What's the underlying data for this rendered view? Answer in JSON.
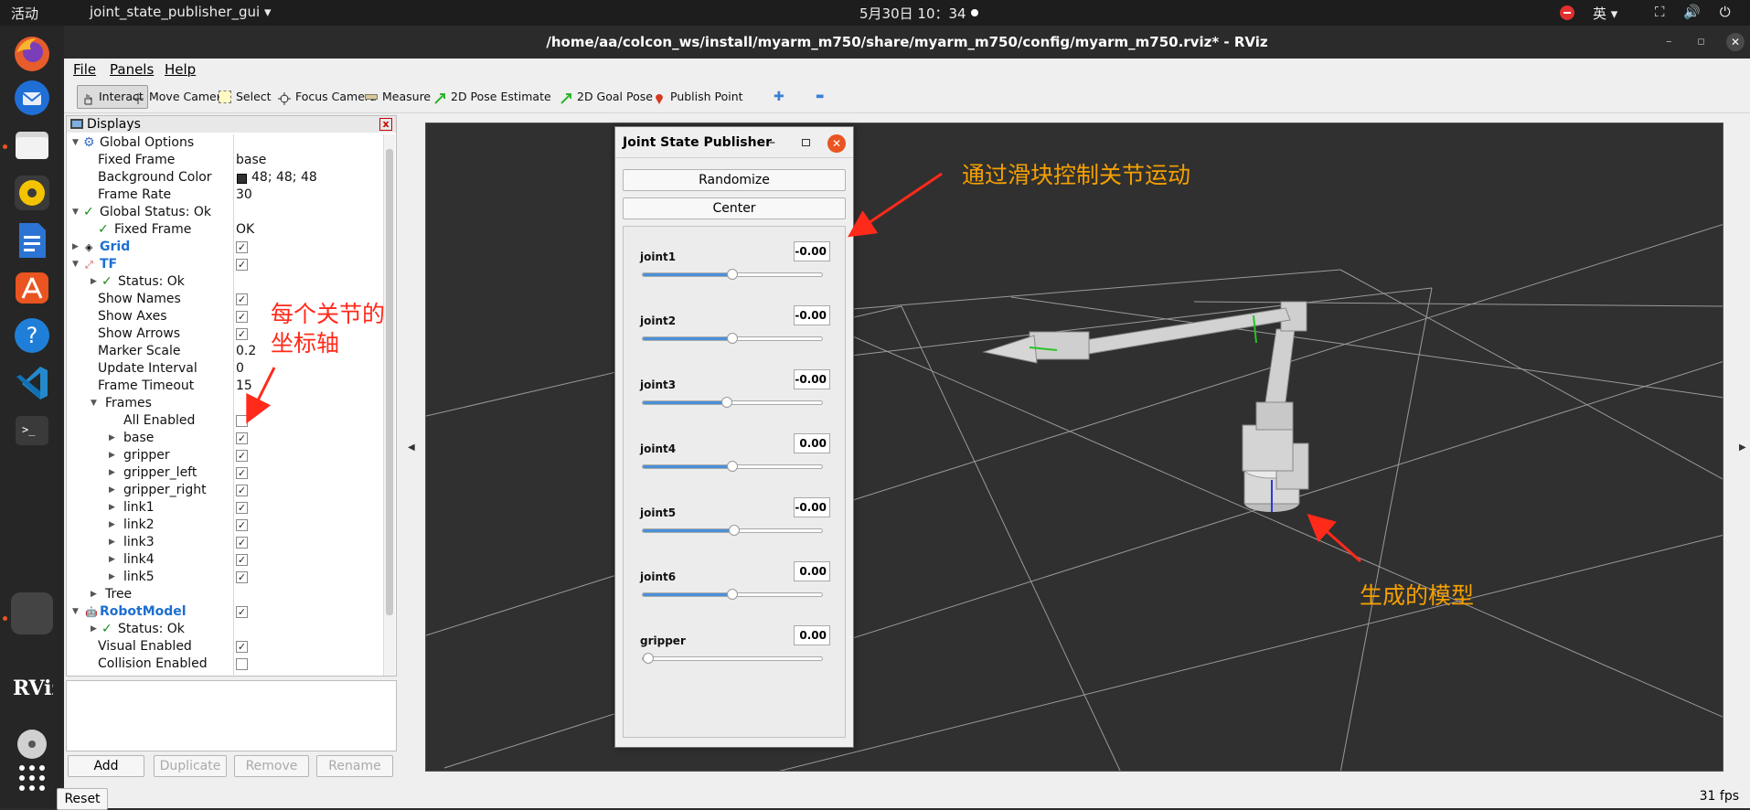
{
  "topbar": {
    "activities": "活动",
    "app_menu": "joint_state_publisher_gui ▾",
    "clock": "5月30日  10：34",
    "input_method": "英 ▾",
    "tray": "⛶ 🔊 ⏻ ▾"
  },
  "window": {
    "title": "/home/aa/colcon_ws/install/myarm_m750/share/myarm_m750/config/myarm_m750.rviz* - RViz",
    "min": "–",
    "max": "▫",
    "close": "✕"
  },
  "menu": {
    "file": "File",
    "panels": "Panels",
    "help": "Help"
  },
  "toolbar": {
    "interact": "Interact",
    "move_camera": "Move Camera",
    "select": "Select",
    "focus_camera": "Focus Camera",
    "measure": "Measure",
    "pose_estimate": "2D Pose Estimate",
    "goal_pose": "2D Goal Pose",
    "publish_point": "Publish Point",
    "plus": "✚",
    "minus": "▬"
  },
  "displays": {
    "title": "Displays",
    "rows": {
      "global_options": "Global Options",
      "fixed_frame": "Fixed Frame",
      "fixed_frame_val": "base",
      "bg_color": "Background Color",
      "bg_color_val": "48; 48; 48",
      "frame_rate": "Frame Rate",
      "frame_rate_val": "30",
      "global_status": "Global Status: Ok",
      "fixed_frame_status": "Fixed Frame",
      "fixed_frame_status_val": "OK",
      "grid": "Grid",
      "tf": "TF",
      "tf_status": "Status: Ok",
      "show_names": "Show Names",
      "show_axes": "Show Axes",
      "show_arrows": "Show Arrows",
      "marker_scale": "Marker Scale",
      "marker_scale_val": "0.2",
      "update_interval": "Update Interval",
      "update_interval_val": "0",
      "frame_timeout": "Frame Timeout",
      "frame_timeout_val": "15",
      "frames": "Frames",
      "all_enabled": "All Enabled",
      "base": "base",
      "gripper": "gripper",
      "gripper_left": "gripper_left",
      "gripper_right": "gripper_right",
      "link1": "link1",
      "link2": "link2",
      "link3": "link3",
      "link4": "link4",
      "link5": "link5",
      "tree": "Tree",
      "robot_model": "RobotModel",
      "rm_status": "Status: Ok",
      "visual_enabled": "Visual Enabled",
      "collision_enabled": "Collision Enabled"
    },
    "buttons": {
      "add": "Add",
      "duplicate": "Duplicate",
      "remove": "Remove",
      "rename": "Rename"
    },
    "reset": "Reset"
  },
  "background_color_hex": "#303030",
  "fps": "31 fps",
  "jsp": {
    "title": "Joint State Publisher",
    "min": "–",
    "close": "✕",
    "randomize": "Randomize",
    "center": "Center",
    "joints": [
      {
        "name": "joint1",
        "value": "-0.00",
        "fraction": 0.5
      },
      {
        "name": "joint2",
        "value": "-0.00",
        "fraction": 0.5
      },
      {
        "name": "joint3",
        "value": "-0.00",
        "fraction": 0.47
      },
      {
        "name": "joint4",
        "value": "0.00",
        "fraction": 0.5
      },
      {
        "name": "joint5",
        "value": "-0.00",
        "fraction": 0.51
      },
      {
        "name": "joint6",
        "value": "0.00",
        "fraction": 0.5
      },
      {
        "name": "gripper",
        "value": "0.00",
        "fraction": 0.0
      }
    ]
  },
  "annotations": {
    "axes_line1": "每个关节的",
    "axes_line2": "坐标轴",
    "slider_note": "通过滑块控制关节运动",
    "model_note": "生成的模型",
    "red": "#ff2a1a",
    "orange": "#f5a000"
  }
}
